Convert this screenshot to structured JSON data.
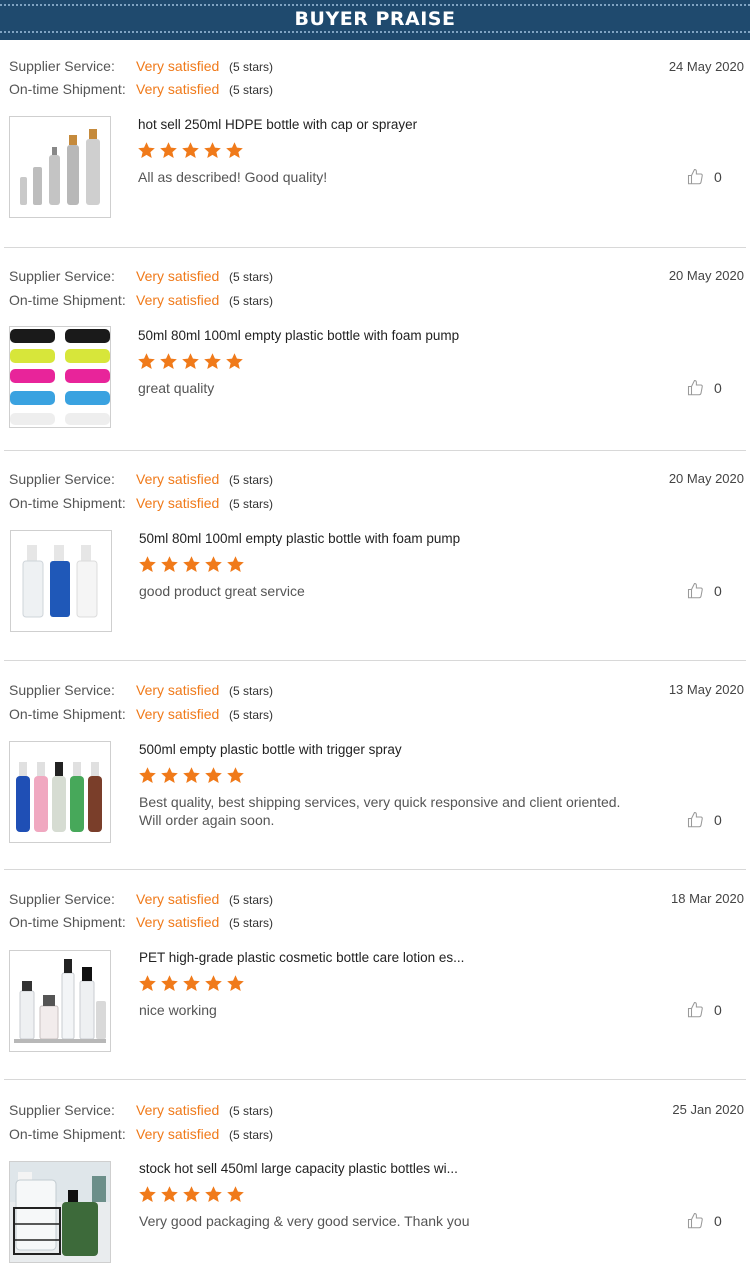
{
  "header": {
    "title": "BUYER PRAISE"
  },
  "labels": {
    "supplier_service": "Supplier Service:",
    "ontime_shipment": "On-time Shipment:"
  },
  "colors": {
    "accent": "#f07a1a",
    "header_bg": "#1f4a6e"
  },
  "reviews": [
    {
      "supplier_value": "Very satisfied",
      "supplier_stars": "(5 stars)",
      "shipment_value": "Very satisfied",
      "shipment_stars": "(5 stars)",
      "date": "24 May 2020",
      "product_title": "hot sell 250ml HDPE bottle with cap or sprayer",
      "rating": 5,
      "comment": "All as described! Good quality!",
      "likes": "0",
      "thumb_icon": "silver-bottles-image"
    },
    {
      "supplier_value": "Very satisfied",
      "supplier_stars": "(5 stars)",
      "shipment_value": "Very satisfied",
      "shipment_stars": "(5 stars)",
      "date": "20 May 2020",
      "product_title": "50ml 80ml 100ml empty plastic bottle with foam pump",
      "rating": 5,
      "comment": "great quality",
      "likes": "0",
      "thumb_icon": "colored-spray-pumps-image"
    },
    {
      "supplier_value": "Very satisfied",
      "supplier_stars": "(5 stars)",
      "shipment_value": "Very satisfied",
      "shipment_stars": "(5 stars)",
      "date": "20 May 2020",
      "product_title": "50ml 80ml 100ml empty plastic bottle with foam pump",
      "rating": 5,
      "comment": "good product great service",
      "likes": "0",
      "thumb_icon": "foam-pump-bottles-image"
    },
    {
      "supplier_value": "Very satisfied",
      "supplier_stars": "(5 stars)",
      "shipment_value": "Very satisfied",
      "shipment_stars": "(5 stars)",
      "date": "13 May 2020",
      "product_title": "500ml empty plastic bottle with trigger spray",
      "rating": 5,
      "comment": "Best quality, best shipping services, very quick responsive and client oriented. Will order again soon.",
      "likes": "0",
      "thumb_icon": "colored-spray-bottles-image"
    },
    {
      "supplier_value": "Very satisfied",
      "supplier_stars": "(5 stars)",
      "shipment_value": "Very satisfied",
      "shipment_stars": "(5 stars)",
      "date": "18 Mar 2020",
      "product_title": "PET high-grade plastic cosmetic bottle care lotion es...",
      "rating": 5,
      "comment": "nice working",
      "likes": "0",
      "thumb_icon": "cosmetic-bottles-image"
    },
    {
      "supplier_value": "Very satisfied",
      "supplier_stars": "(5 stars)",
      "shipment_value": "Very satisfied",
      "shipment_stars": "(5 stars)",
      "date": "25 Jan 2020",
      "product_title": "stock hot sell 450ml large capacity plastic bottles wi...",
      "rating": 5,
      "comment": "Very good packaging & very good service. Thank you",
      "likes": "0",
      "thumb_icon": "foam-bottles-basket-image"
    }
  ]
}
